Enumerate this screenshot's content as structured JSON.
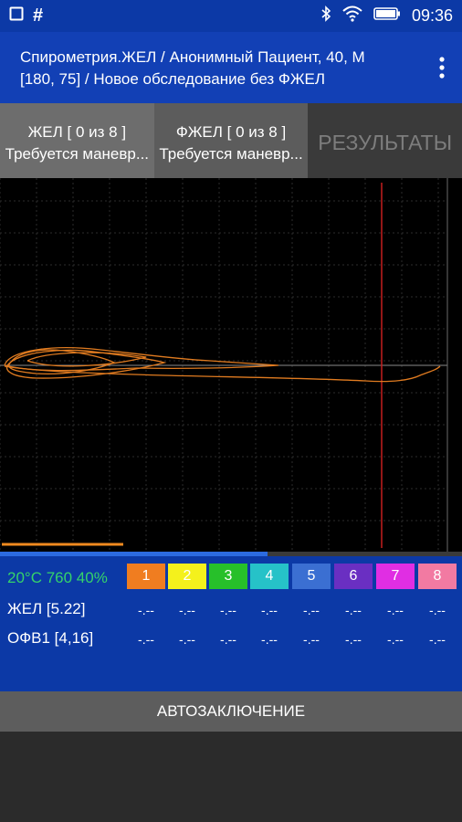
{
  "status_bar": {
    "left_icons": [
      "notification-square-icon",
      "hash-icon"
    ],
    "hash": "#",
    "right_icons": [
      "bluetooth-icon",
      "wifi-icon",
      "battery-icon"
    ],
    "time": "09:36"
  },
  "header": {
    "line1": "Спирометрия.ЖЕЛ  /  Анонимный Пациент, 40, М",
    "line2": "[180, 75]  /  Новое обследование без ФЖЕЛ",
    "menu_icon": "more-vert-icon"
  },
  "tabs": [
    {
      "title": "ЖЕЛ  [ 0 из 8 ]",
      "subtitle": "Требуется маневр..."
    },
    {
      "title": "ФЖЕЛ  [ 0 из 8 ]",
      "subtitle": "Требуется маневр..."
    },
    {
      "title": "РЕЗУЛЬТАТЫ"
    }
  ],
  "chart_data": {
    "type": "line",
    "grid": true,
    "series_color": "#e07b20",
    "marker_color": "#c41e1e",
    "progress_fraction": 0.58
  },
  "panel": {
    "conditions": "20°C 760 40%",
    "slots": [
      {
        "label": "1",
        "color": "#f07d20"
      },
      {
        "label": "2",
        "color": "#f4f11c"
      },
      {
        "label": "3",
        "color": "#27c02a"
      },
      {
        "label": "4",
        "color": "#26c2c8"
      },
      {
        "label": "5",
        "color": "#3b6fd2"
      },
      {
        "label": "6",
        "color": "#6a2fc2"
      },
      {
        "label": "7",
        "color": "#e02ee3"
      },
      {
        "label": "8",
        "color": "#f27aa2"
      }
    ],
    "rows": [
      {
        "label": "ЖЕЛ [5.22]",
        "values": [
          "-.--",
          "-.--",
          "-.--",
          "-.--",
          "-.--",
          "-.--",
          "-.--",
          "-.--"
        ]
      },
      {
        "label": "ОФВ1 [4,16]",
        "values": [
          "-.--",
          "-.--",
          "-.--",
          "-.--",
          "-.--",
          "-.--",
          "-.--",
          "-.--"
        ]
      }
    ]
  },
  "auto_conclusion": "АВТОЗАКЛЮЧЕНИЕ"
}
